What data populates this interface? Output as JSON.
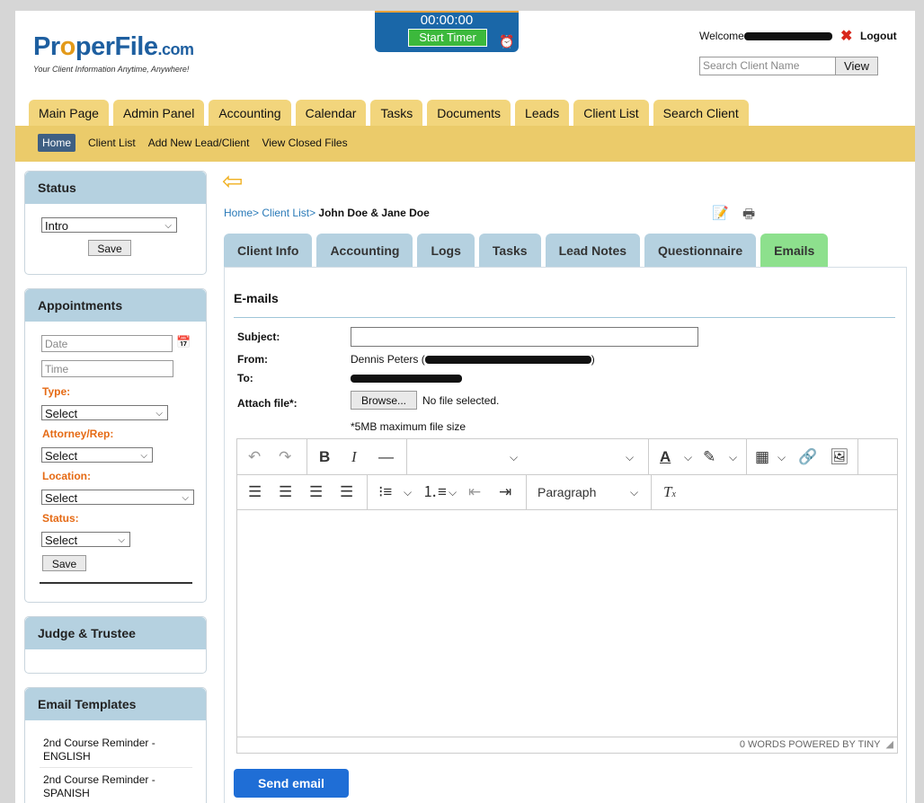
{
  "header": {
    "brand_pre": "Pr",
    "brand_o": "o",
    "brand_post": "perFile",
    "brand_tld": ".com",
    "tagline": "Your Client Information Anytime, Anywhere!",
    "timer": "00:00:00",
    "start_timer": "Start Timer",
    "welcome": "Welcome",
    "logout": "Logout",
    "search_placeholder": "Search Client Name",
    "view": "View"
  },
  "main_tabs": [
    "Main Page",
    "Admin Panel",
    "Accounting",
    "Calendar",
    "Tasks",
    "Documents",
    "Leads",
    "Client List",
    "Search Client"
  ],
  "sub_nav": [
    "Home",
    "Client List",
    "Add New Lead/Client",
    "View Closed Files"
  ],
  "sidebar": {
    "status": {
      "title": "Status",
      "value": "Intro",
      "save": "Save"
    },
    "appointments": {
      "title": "Appointments",
      "date_placeholder": "Date",
      "time_placeholder": "Time",
      "type_label": "Type:",
      "type_value": "Select",
      "attorney_label": "Attorney/Rep:",
      "attorney_value": "Select",
      "location_label": "Location:",
      "location_value": "Select",
      "status_label": "Status:",
      "status_value": "Select",
      "save": "Save"
    },
    "judge": {
      "title": "Judge & Trustee"
    },
    "templates": {
      "title": "Email Templates",
      "items": [
        "2nd Course Reminder - ENGLISH",
        "2nd Course Reminder - SPANISH"
      ]
    }
  },
  "breadcrumb": {
    "home": "Home>",
    "client_list": "Client List>",
    "current": "John Doe & Jane Doe"
  },
  "client_tabs": [
    "Client Info",
    "Accounting",
    "Logs",
    "Tasks",
    "Lead Notes",
    "Questionnaire",
    "Emails"
  ],
  "email": {
    "title": "E-mails",
    "subject_label": "Subject:",
    "from_label": "From:",
    "from_name": "Dennis Peters (",
    "from_close": ")",
    "to_label": "To:",
    "attach_label": "Attach file*:",
    "browse": "Browse...",
    "no_file": "No file selected.",
    "max_size": "*5MB maximum file size",
    "paragraph": "Paragraph",
    "status_bar": "0 WORDS  POWERED BY TINY",
    "send": "Send email"
  },
  "colors": {
    "tab": "#f2d57c",
    "subnav": "#ebcb6a",
    "panel_header": "#b5d1e0",
    "active_tab": "#8de08d",
    "send": "#1f6ed6",
    "accent_label": "#e56a14"
  }
}
